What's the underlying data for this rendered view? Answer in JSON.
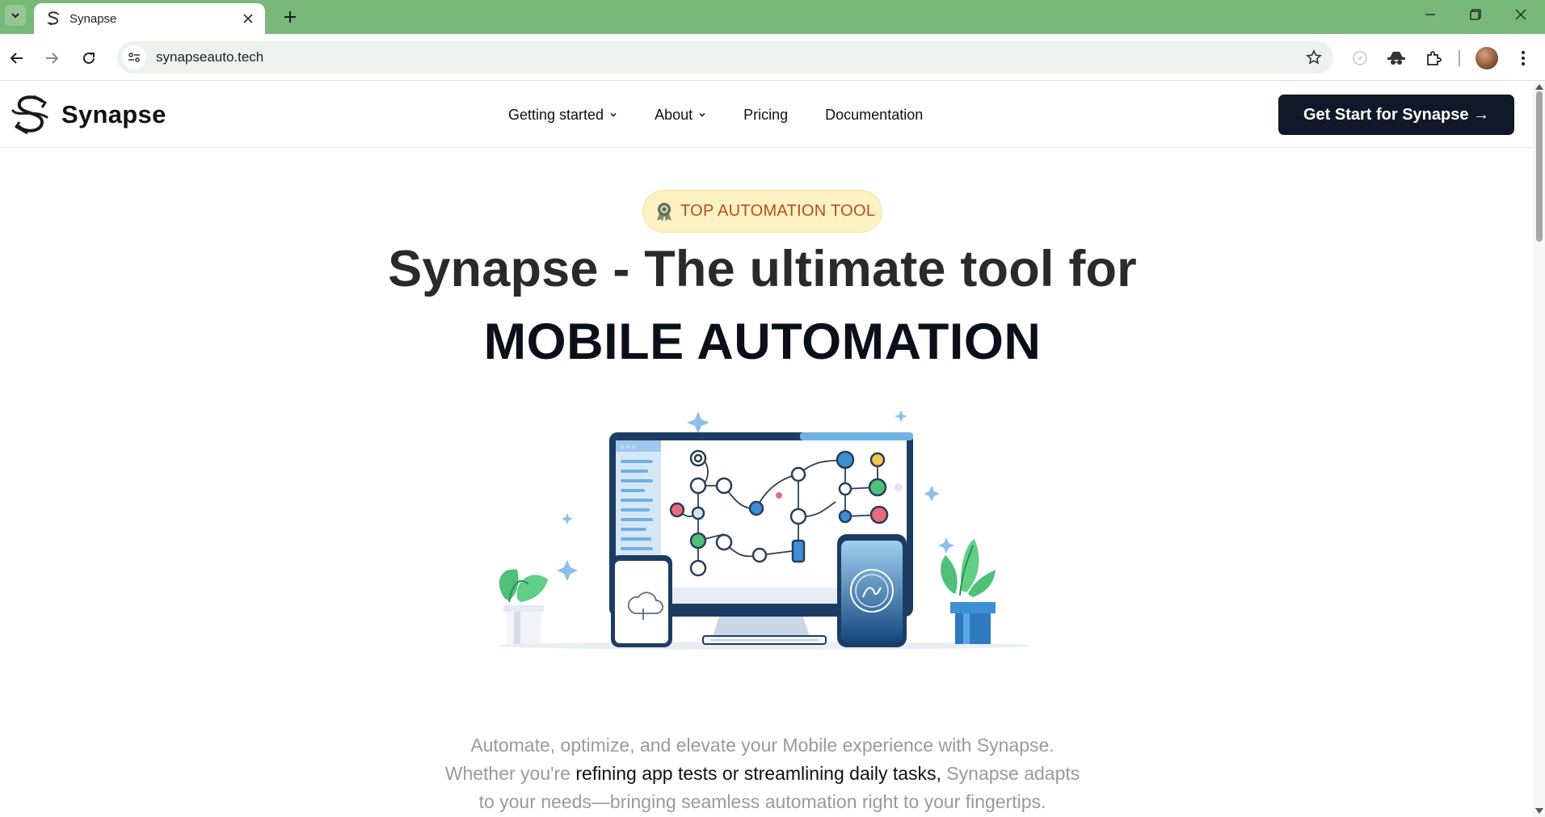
{
  "browser": {
    "tab_title": "Synapse",
    "url": "synapseauto.tech"
  },
  "header": {
    "logo_text": "Synapse",
    "nav": {
      "getting_started": "Getting started",
      "about": "About",
      "pricing": "Pricing",
      "documentation": "Documentation"
    },
    "cta_label": "Get Start for Synapse →"
  },
  "hero": {
    "badge": "TOP AUTOMATION TOOL",
    "headline_line1": "Synapse - The ultimate tool for",
    "headline_line2": "MOBILE AUTOMATION",
    "desc_line1": "Automate, optimize, and elevate your Mobile experience with Synapse.",
    "desc_line2_a": "Whether you're ",
    "desc_line2_b": "refining app tests or streamlining daily tasks,",
    "desc_line2_c": " Synapse adapts",
    "desc_line3": "to your needs—bringing seamless automation right to your fingertips."
  },
  "colors": {
    "chrome_green": "#78b879",
    "cta_bg": "#111827",
    "badge_bg": "#fdf1c4",
    "badge_text": "#b4501a"
  }
}
